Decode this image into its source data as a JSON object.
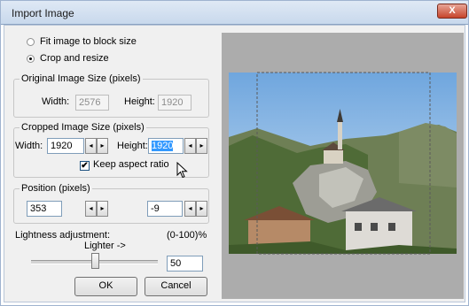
{
  "window": {
    "title": "Import Image",
    "close_label": "X"
  },
  "options": {
    "fit_label": "Fit image to block size",
    "crop_label": "Crop and resize",
    "selected": "crop"
  },
  "original_size": {
    "legend": "Original Image Size (pixels)",
    "width_label": "Width:",
    "width_value": "2576",
    "height_label": "Height:",
    "height_value": "1920"
  },
  "cropped_size": {
    "legend": "Cropped Image Size  (pixels)",
    "width_label": "Width:",
    "width_value": "1920",
    "height_label": "Height:",
    "height_value": "1920",
    "keep_aspect_label": "Keep aspect ratio",
    "keep_aspect_checked": true
  },
  "position": {
    "legend": "Position (pixels)",
    "x_value": "353",
    "y_value": "-9"
  },
  "lightness": {
    "label": "Lightness adjustment:",
    "range_label": "(0-100)%",
    "direction_label": "Lighter ->",
    "value": "50",
    "level": 0.5
  },
  "buttons": {
    "ok": "OK",
    "cancel": "Cancel"
  },
  "spin": {
    "left": "◂",
    "right": "▸"
  },
  "colors": {
    "selection": "#3399ff",
    "preview_background": "#acacac",
    "close_button": "#c6432a"
  }
}
